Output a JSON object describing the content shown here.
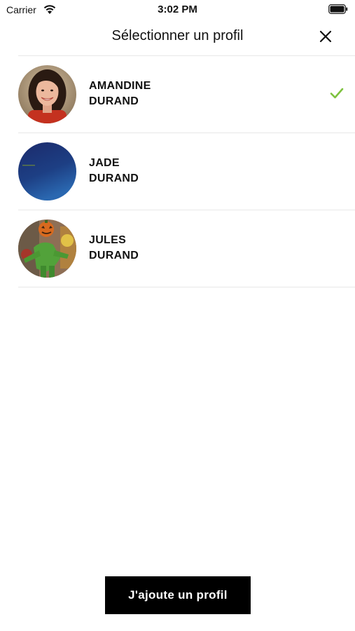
{
  "status_bar": {
    "carrier": "Carrier",
    "time": "3:02 PM",
    "wifi_icon": "wifi-icon",
    "battery_icon": "battery-icon"
  },
  "header": {
    "title": "Sélectionner un profil",
    "close_icon": "close-icon"
  },
  "profiles": [
    {
      "first_name": "AMANDINE",
      "last_name": "DURAND",
      "selected": true,
      "avatar": "photo-woman-smiling"
    },
    {
      "first_name": "JADE",
      "last_name": "DURAND",
      "selected": false,
      "avatar": "dark-blue-gradient"
    },
    {
      "first_name": "JULES",
      "last_name": "DURAND",
      "selected": false,
      "avatar": "photo-pumpkin-costume"
    }
  ],
  "colors": {
    "accent_check": "#7dc23e",
    "button_background": "#000000",
    "button_text": "#ffffff",
    "divider": "#e8e8e8"
  },
  "add_button": {
    "label": "J'ajoute un profil"
  }
}
